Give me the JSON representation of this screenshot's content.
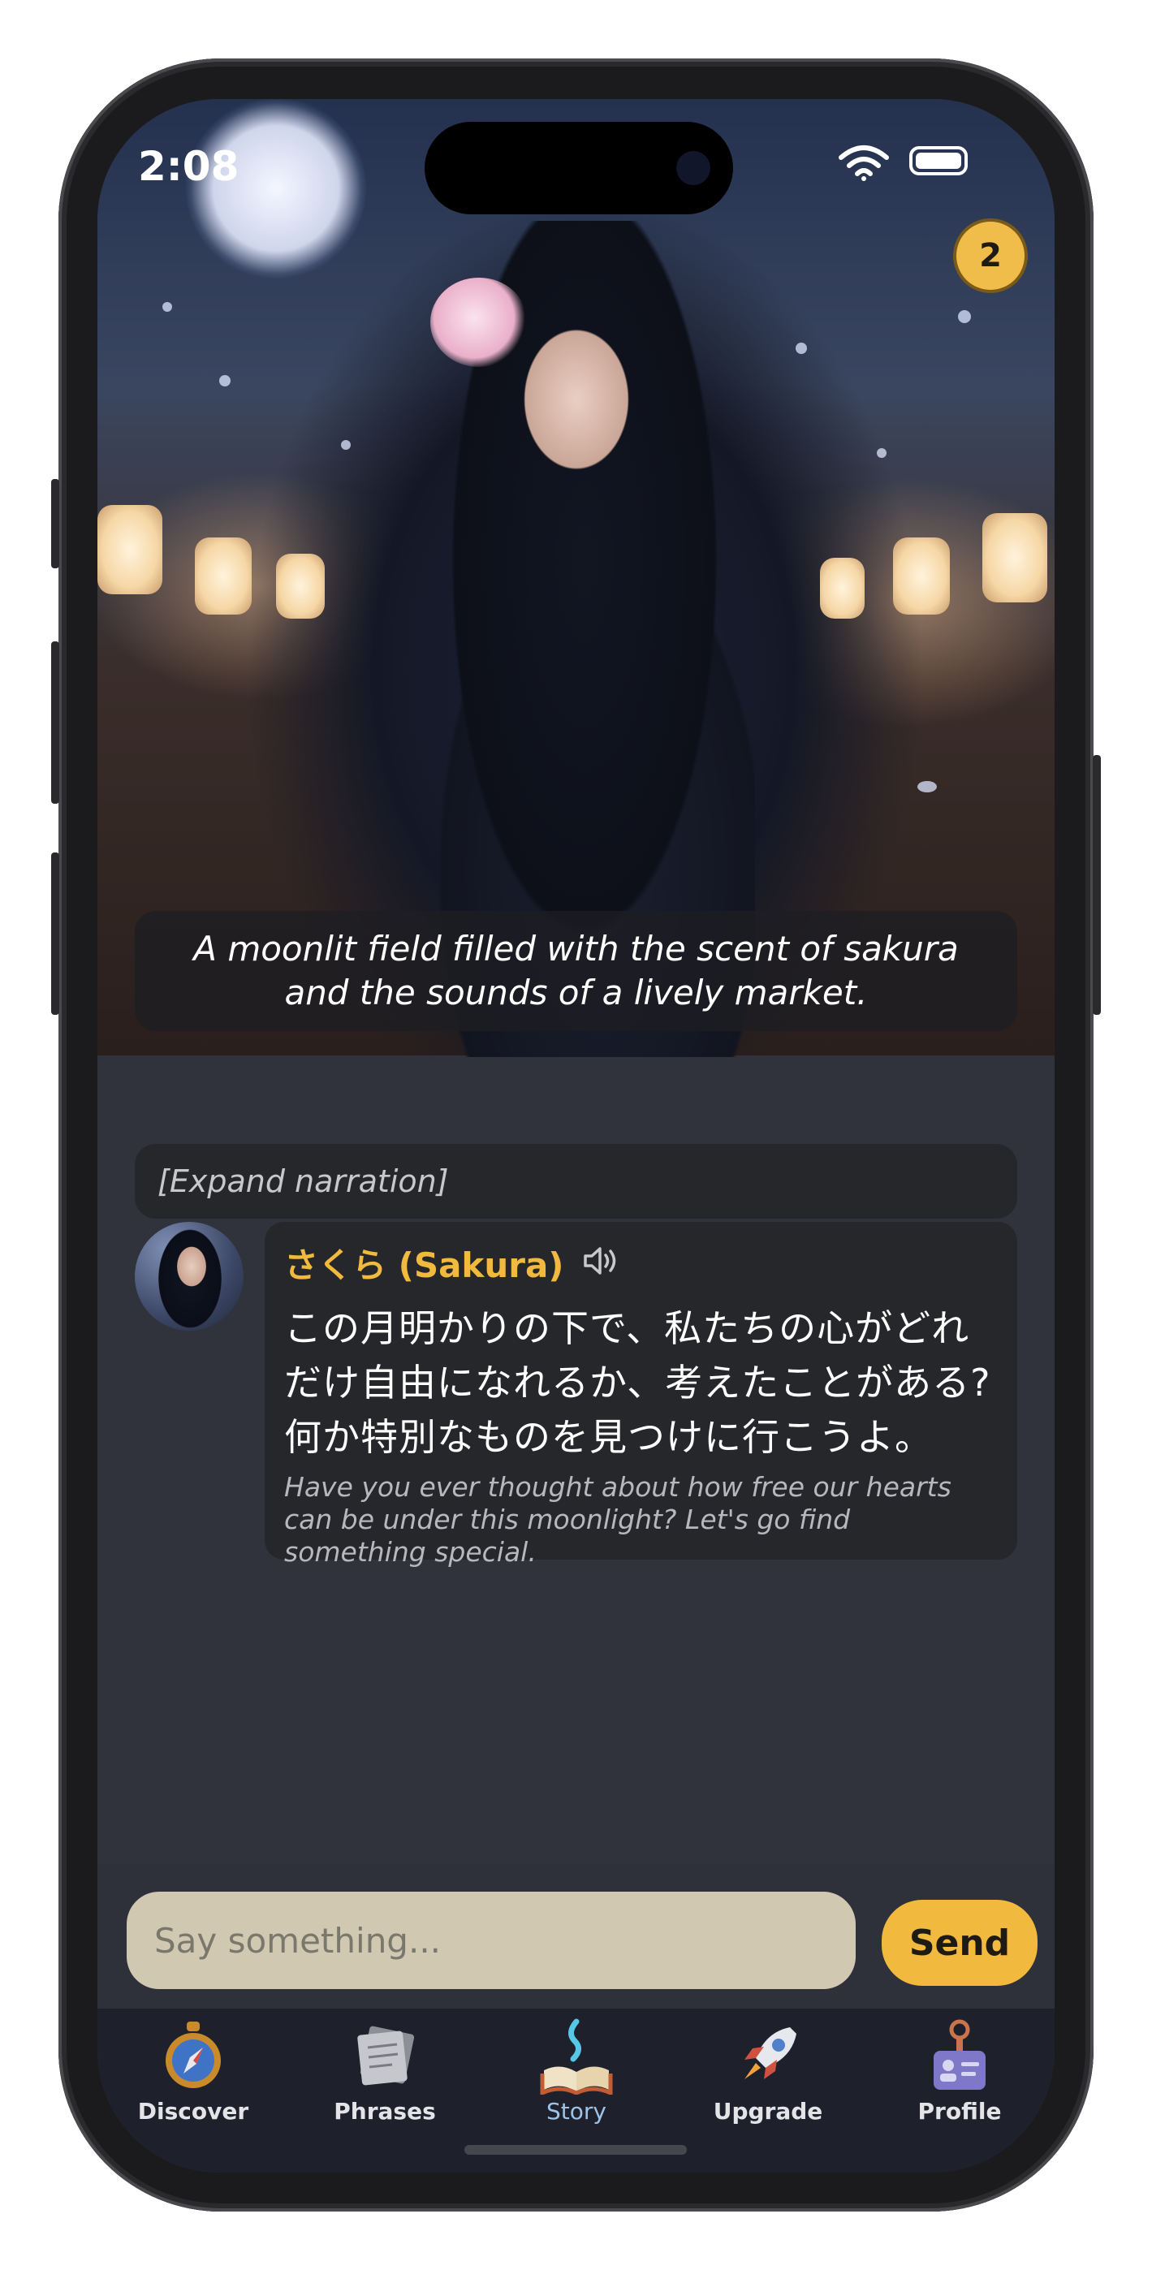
{
  "status_bar": {
    "time": "2:08"
  },
  "badge": {
    "count": "2"
  },
  "scene": {
    "caption": "A moonlit field filled with the scent of sakura and the sounds of a lively market."
  },
  "narration": {
    "expand_label": "[Expand narration]"
  },
  "message": {
    "speaker": "さくら (Sakura)",
    "japanese": "この月明かりの下で、私たちの心がどれだけ自由になれるか、考えたことがある? 何か特別なものを見つけに行こうよ。",
    "translation": "Have you ever thought about how free our hearts can be under this moonlight? Let's go find something special."
  },
  "composer": {
    "placeholder": "Say something...",
    "send_label": "Send"
  },
  "tabs": [
    {
      "label": "Discover",
      "icon": "compass-icon"
    },
    {
      "label": "Phrases",
      "icon": "notes-icon"
    },
    {
      "label": "Story",
      "icon": "book-icon",
      "active": true
    },
    {
      "label": "Upgrade",
      "icon": "rocket-icon"
    },
    {
      "label": "Profile",
      "icon": "id-badge-icon"
    }
  ],
  "colors": {
    "accent": "#f1b93d",
    "background": "#30323c",
    "card": "#26272b",
    "tabbar": "#1e212b",
    "input": "#d0c8b0",
    "active_tab": "#9ec3e8"
  }
}
